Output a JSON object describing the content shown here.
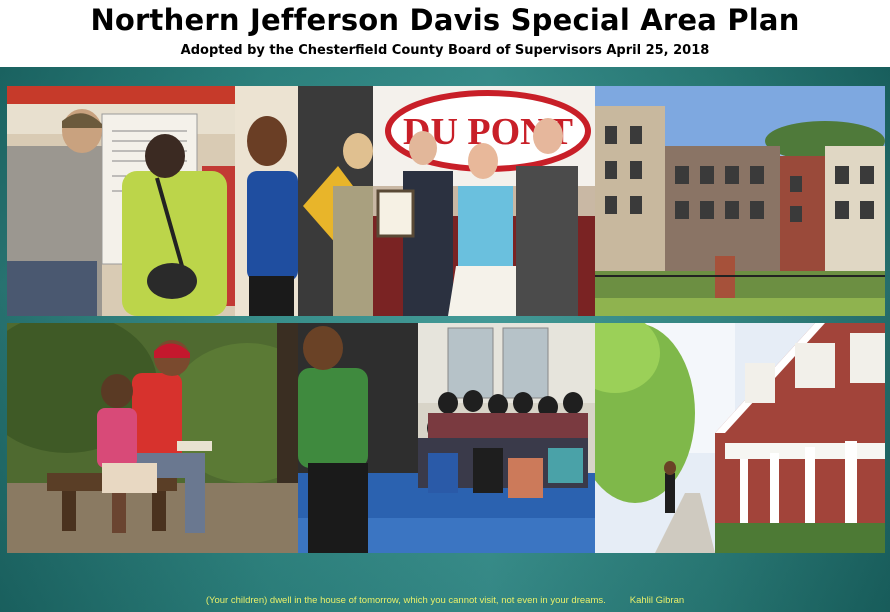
{
  "header": {
    "title": "Northern Jefferson Davis Special Area Plan",
    "subtitle": "Adopted by the Chesterfield County Board of Supervisors April 25, 2018"
  },
  "photos": {
    "p1": {
      "name": "community-meeting-photo"
    },
    "p2": {
      "name": "dupont-award-photo",
      "sign_text": "DU PONT"
    },
    "p3": {
      "name": "apartment-buildings-photo"
    },
    "p4": {
      "name": "father-child-reading-photo"
    },
    "p5": {
      "name": "children-classroom-photo"
    },
    "p6": {
      "name": "townhouses-street-photo"
    }
  },
  "footer": {
    "quote": "(Your children) dwell in the house of tomorrow, which you cannot visit, not even in your dreams.",
    "author": "Kahlil Gibran"
  },
  "colors": {
    "background_teal": "#2f8a86",
    "quote_yellow": "#e9f06a"
  }
}
